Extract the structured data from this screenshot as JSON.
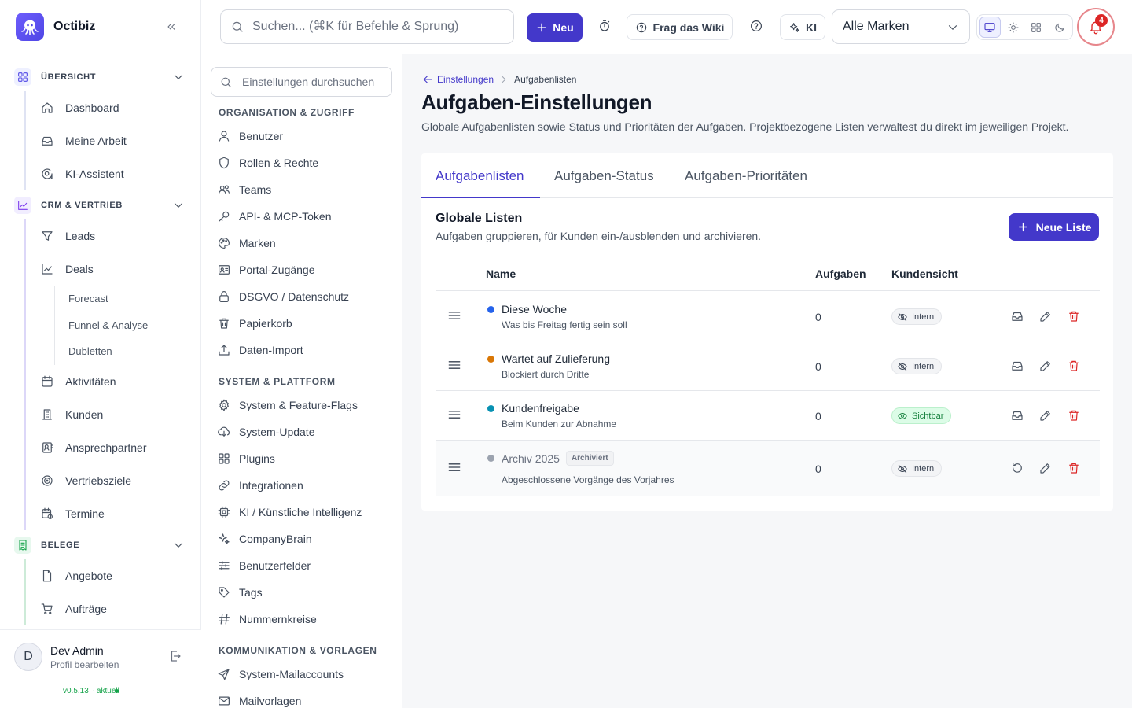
{
  "app": {
    "name": "Octibiz"
  },
  "sidebar": {
    "groups": [
      {
        "label": "ÜBERSICHT",
        "items": [
          "Dashboard",
          "Meine Arbeit",
          "KI-Assistent"
        ]
      },
      {
        "label": "CRM & VERTRIEB",
        "items": [
          "Leads",
          "Deals",
          "Aktivitäten",
          "Kunden",
          "Ansprechpartner",
          "Vertriebsziele",
          "Termine"
        ],
        "deal_subitems": [
          "Forecast",
          "Funnel & Analyse",
          "Dubletten"
        ]
      },
      {
        "label": "BELEGE",
        "items": [
          "Angebote",
          "Aufträge"
        ]
      }
    ],
    "user": {
      "initial": "D",
      "name": "Dev Admin",
      "sub": "Profil bearbeiten"
    },
    "version": "v0.5.13",
    "version_status": "· aktuell"
  },
  "topbar": {
    "search_placeholder": "Suchen... (⌘K für Befehle & Sprung)",
    "new_label": "Neu",
    "wiki_label": "Frag das Wiki",
    "ki_label": "KI",
    "brand_select": "Alle Marken",
    "notification_count": "4"
  },
  "settings_nav": {
    "search_placeholder": "Einstellungen durchsuchen",
    "sections": [
      {
        "title": "ORGANISATION & ZUGRIFF",
        "items": [
          "Benutzer",
          "Rollen & Rechte",
          "Teams",
          "API- & MCP-Token",
          "Marken",
          "Portal-Zugänge",
          "DSGVO / Datenschutz",
          "Papierkorb",
          "Daten-Import"
        ]
      },
      {
        "title": "SYSTEM & PLATTFORM",
        "items": [
          "System & Feature-Flags",
          "System-Update",
          "Plugins",
          "Integrationen",
          "KI / Künstliche Intelligenz",
          "CompanyBrain",
          "Benutzerfelder",
          "Tags",
          "Nummernkreise"
        ]
      },
      {
        "title": "KOMMUNIKATION & VORLAGEN",
        "items": [
          "System-Mailaccounts",
          "Mailvorlagen"
        ]
      }
    ]
  },
  "main": {
    "breadcrumb_back": "Einstellungen",
    "breadcrumb_current": "Aufgabenlisten",
    "title": "Aufgaben-Einstellungen",
    "description": "Globale Aufgabenlisten sowie Status und Prioritäten der Aufgaben. Projektbezogene Listen verwaltest du direkt im jeweiligen Projekt.",
    "tabs": [
      "Aufgabenlisten",
      "Aufgaben-Status",
      "Aufgaben-Prioritäten"
    ],
    "list_title": "Globale Listen",
    "list_subtitle": "Aufgaben gruppieren, für Kunden ein-/ausblenden und archivieren.",
    "new_list_label": "Neue Liste",
    "columns": {
      "name": "Name",
      "tasks": "Aufgaben",
      "visibility": "Kundensicht"
    },
    "rows": [
      {
        "name": "Diese Woche",
        "desc": "Was bis Freitag fertig sein soll",
        "count": "0",
        "visibility": "Intern",
        "color": "#2563eb"
      },
      {
        "name": "Wartet auf Zulieferung",
        "desc": "Blockiert durch Dritte",
        "count": "0",
        "visibility": "Intern",
        "color": "#d97706"
      },
      {
        "name": "Kundenfreigabe",
        "desc": "Beim Kunden zur Abnahme",
        "count": "0",
        "visibility": "Sichtbar",
        "color": "#0891b2"
      },
      {
        "name": "Archiv 2025",
        "badge": "Archiviert",
        "desc": "Abgeschlossene Vorgänge des Vorjahres",
        "count": "0",
        "visibility": "Intern",
        "color": "#9ca3af"
      }
    ]
  },
  "colors": {
    "accent": "#4338ca",
    "danger": "#dc2626",
    "success": "#15803d"
  }
}
